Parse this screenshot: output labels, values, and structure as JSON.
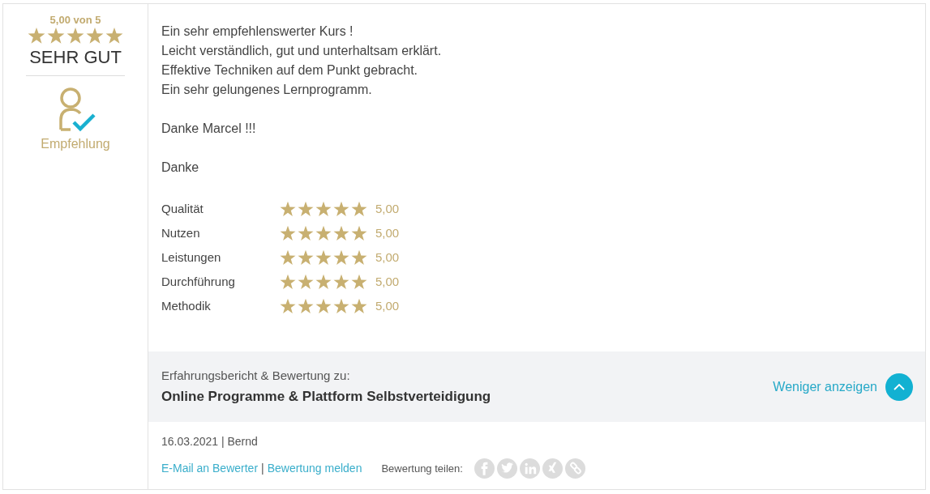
{
  "summary": {
    "score": "5,00 von 5",
    "stars": 5,
    "verdict": "SEHR GUT",
    "recommendation": "Empfehlung"
  },
  "review": {
    "paragraphs": [
      [
        "Ein sehr empfehlenswerter Kurs !",
        "Leicht verständlich, gut und unterhaltsam erklärt.",
        "Effektive Techniken auf dem Punkt gebracht.",
        "Ein sehr gelungenes Lernprogramm."
      ],
      [
        "Danke Marcel !!!"
      ],
      [
        "Danke"
      ]
    ]
  },
  "criteria": [
    {
      "label": "Qualität",
      "stars": 5,
      "value": "5,00"
    },
    {
      "label": "Nutzen",
      "stars": 5,
      "value": "5,00"
    },
    {
      "label": "Leistungen",
      "stars": 5,
      "value": "5,00"
    },
    {
      "label": "Durchführung",
      "stars": 5,
      "value": "5,00"
    },
    {
      "label": "Methodik",
      "stars": 5,
      "value": "5,00"
    }
  ],
  "subject": {
    "intro": "Erfahrungsbericht & Bewertung zu:",
    "title": "Online Programme & Plattform Selbstverteidigung",
    "toggle": "Weniger anzeigen",
    "expanded": true
  },
  "meta": "16.03.2021 | Bernd",
  "links": [
    "E-Mail an Bewerter",
    "Bewertung melden"
  ],
  "link_separator": "|",
  "share": {
    "label": "Bewertung teilen:",
    "icons": [
      {
        "kind": "facebook"
      },
      {
        "kind": "twitter"
      },
      {
        "kind": "linkedin"
      },
      {
        "kind": "xing"
      },
      {
        "kind": "link"
      }
    ]
  }
}
